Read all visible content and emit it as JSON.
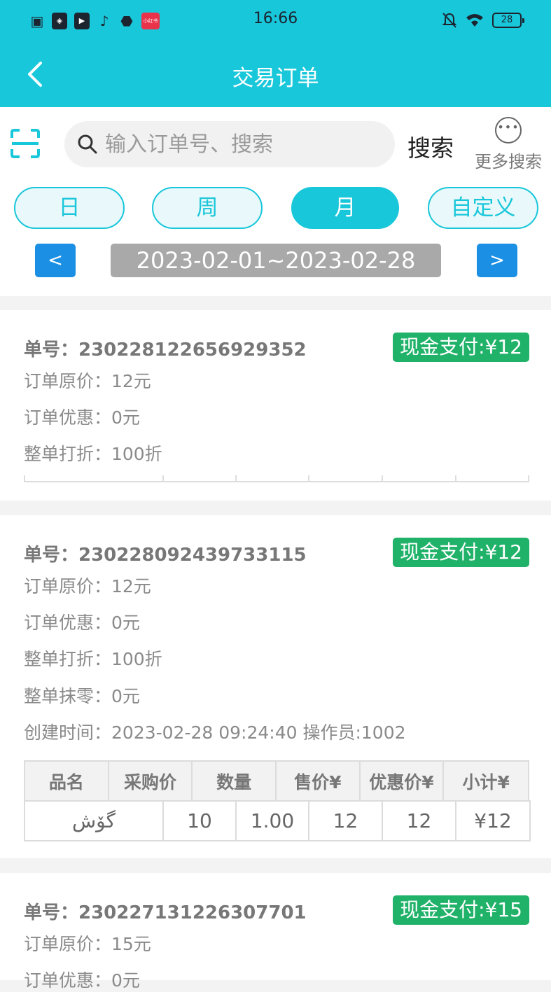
{
  "status": {
    "time": "16:66",
    "battery": "28",
    "icons_left": [
      "sim-icon",
      "app-icon",
      "play-icon",
      "tiktok-icon",
      "android-icon",
      "xiaohongshu-icon"
    ],
    "xhs_label": "小红书"
  },
  "header": {
    "title": "交易订单"
  },
  "search": {
    "placeholder": "输入订单号、搜索",
    "button": "搜索",
    "more": "更多搜索"
  },
  "periods": [
    "日",
    "周",
    "月",
    "自定义"
  ],
  "active_period": "月",
  "range": {
    "prev": "<",
    "next": ">",
    "text": "2023-02-01~2023-02-28"
  },
  "orders": [
    {
      "no": "单号：230228122656929352",
      "badge": "现金支付:¥12",
      "original": "订单原价：12元",
      "discount": "订单优惠：0元",
      "rate": "整单打折：100折"
    },
    {
      "no": "单号：230228092439733115",
      "badge": "现金支付:¥12",
      "original": "订单原价：12元",
      "discount": "订单优惠：0元",
      "rate": "整单打折：100折",
      "rounding": "整单抹零：0元",
      "created": "创建时间：2023-02-28 09:24:40 操作员:1002",
      "table": {
        "headers": [
          "品名",
          "采购价",
          "数量",
          "售价¥",
          "优惠价¥",
          "小计¥"
        ],
        "row": [
          "گۆش",
          "10",
          "1.00",
          "12",
          "12",
          "¥12"
        ]
      }
    },
    {
      "no": "单号：230227131226307701",
      "badge": "现金支付:¥15",
      "original": "订单原价：15元",
      "discount": "订单优惠：0元"
    }
  ],
  "colors": {
    "primary": "#19c7da",
    "badge": "#21b26a",
    "nav": "#1a8fe3",
    "range": "#a9a9a9"
  }
}
